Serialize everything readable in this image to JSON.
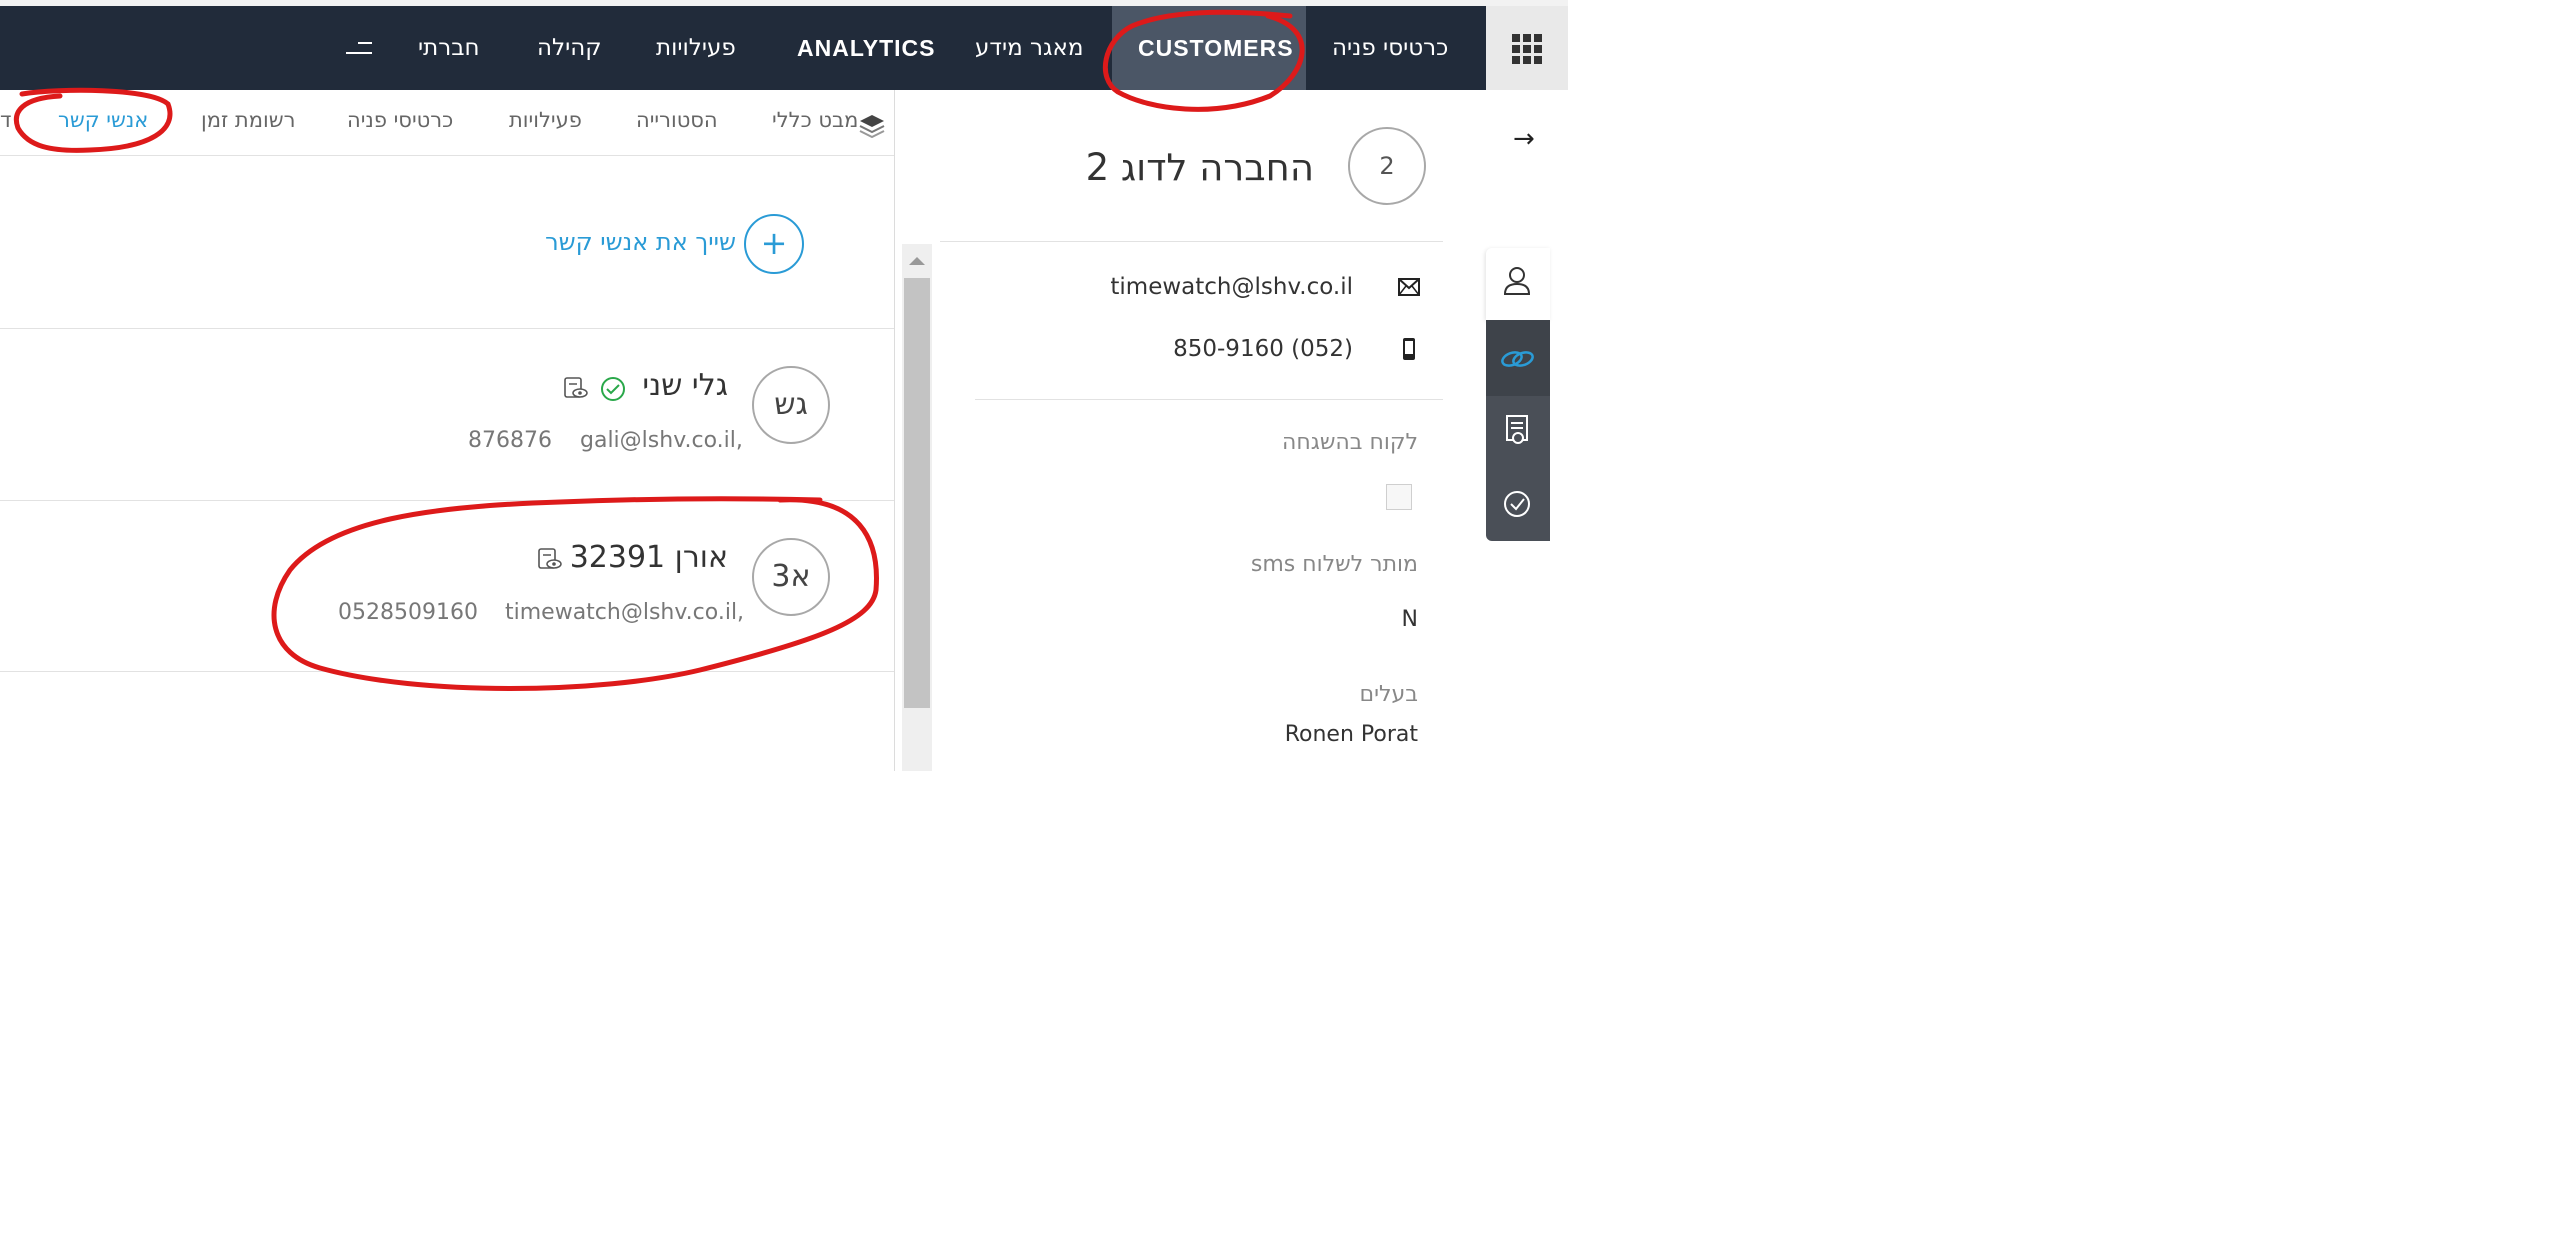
{
  "nav": {
    "items": {
      "face_cards": "כרטיסי פניה",
      "customers": "CUSTOMERS",
      "knowledge_base": "מאגר מידע",
      "analytics": "ANALYTICS",
      "activities": "פעילויות",
      "community": "קהילה",
      "company": "חברתי"
    },
    "active_item": "customers"
  },
  "customer": {
    "avatar_text": "2",
    "name": "החברה לדוג 2",
    "email": "timewatch@lshv.co.il",
    "phone": "850-9160 (052)",
    "fields": {
      "supervised_label": "לקוח בהשגחה",
      "sms_label": "מותר לשלוח sms",
      "sms_value": "N",
      "owner_label": "בעלים",
      "owner_value": "Ronen Porat"
    }
  },
  "tabs": {
    "overview": "מבט כללי",
    "history": "הסטורייה",
    "activities": "פעילויות",
    "face_cards": "כרטיסי פניה",
    "timesheet": "רשומת זמן",
    "contacts": "אנשי קשר",
    "cut": "ד"
  },
  "contacts": {
    "link_label": "שייך את אנשי קשר",
    "items": [
      {
        "initials": "גש",
        "name": "גלי שני",
        "email": "gali@lshv.co.il,",
        "phone": "876876"
      },
      {
        "initials": "א3",
        "name": "אורן 32391",
        "email": "timewatch@lshv.co.il,",
        "phone": "0528509160"
      }
    ]
  },
  "colors": {
    "nav_bg": "#212b3a",
    "nav_active_bg": "#4b5666",
    "link": "#2a9bd6",
    "annotation": "#dd1a1a",
    "verified": "#2aa84a"
  }
}
